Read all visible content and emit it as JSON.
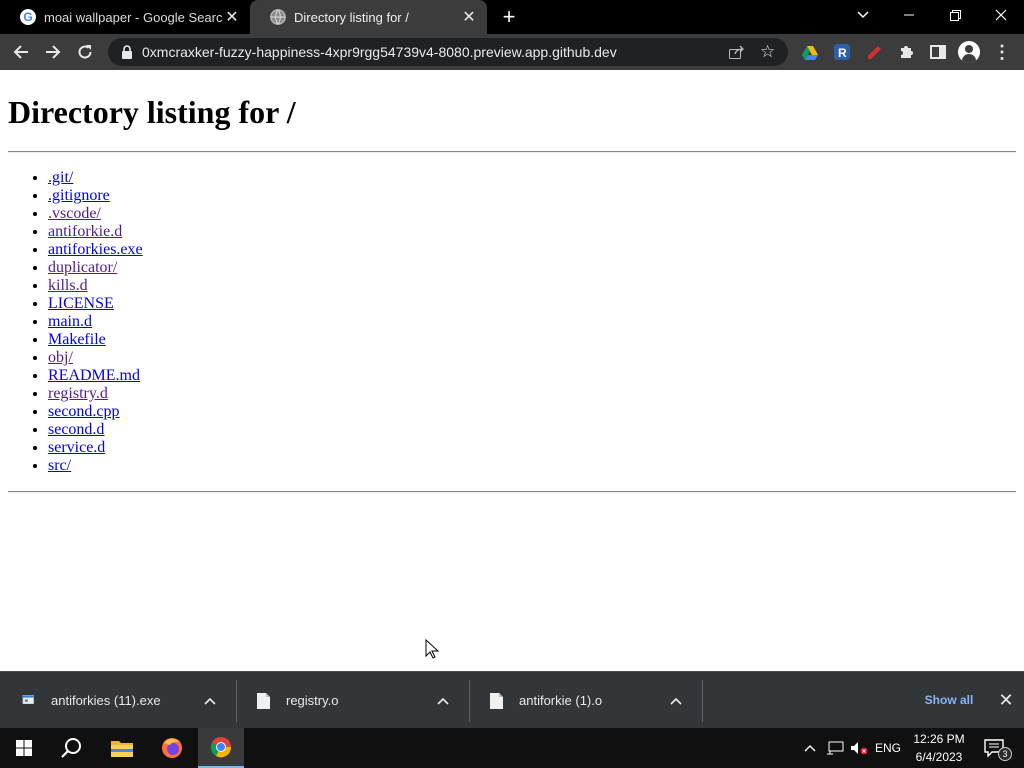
{
  "browser": {
    "tabs": [
      {
        "title": "moai wallpaper - Google Search",
        "favicon": "google-g-icon",
        "active": false
      },
      {
        "title": "Directory listing for /",
        "favicon": "globe-icon",
        "active": true
      }
    ],
    "address_bar": {
      "url": "0xmcraxker-fuzzy-happiness-4xpr9rgg54739v4-8080.preview.app.github.dev"
    }
  },
  "page": {
    "heading": "Directory listing for /",
    "entries": [
      {
        "name": ".git/",
        "visited": false
      },
      {
        "name": ".gitignore",
        "visited": false
      },
      {
        "name": ".vscode/",
        "visited": true
      },
      {
        "name": "antiforkie.d",
        "visited": true
      },
      {
        "name": "antiforkies.exe",
        "visited": false
      },
      {
        "name": "duplicator/",
        "visited": true
      },
      {
        "name": "kills.d",
        "visited": true
      },
      {
        "name": "LICENSE",
        "visited": false
      },
      {
        "name": "main.d",
        "visited": false
      },
      {
        "name": "Makefile",
        "visited": false
      },
      {
        "name": "obj/",
        "visited": true
      },
      {
        "name": "README.md",
        "visited": false
      },
      {
        "name": "registry.d",
        "visited": true
      },
      {
        "name": "second.cpp",
        "visited": false
      },
      {
        "name": "second.d",
        "visited": false
      },
      {
        "name": "service.d",
        "visited": false
      },
      {
        "name": "src/",
        "visited": false
      }
    ]
  },
  "downloads": {
    "items": [
      {
        "filename": "antiforkies (11).exe",
        "icon": "exe-file-icon"
      },
      {
        "filename": "registry.o",
        "icon": "file-icon"
      },
      {
        "filename": "antiforkie (1).o",
        "icon": "file-icon"
      }
    ],
    "show_all_label": "Show all"
  },
  "taskbar": {
    "language": "ENG",
    "time": "12:26 PM",
    "date": "6/4/2023",
    "notification_count": "3"
  },
  "colors": {
    "link": "#0000ee",
    "visited_link": "#551a8b",
    "chrome_dark": "#3c3c3c",
    "shelf": "#323639",
    "show_all": "#8ab4f8"
  }
}
